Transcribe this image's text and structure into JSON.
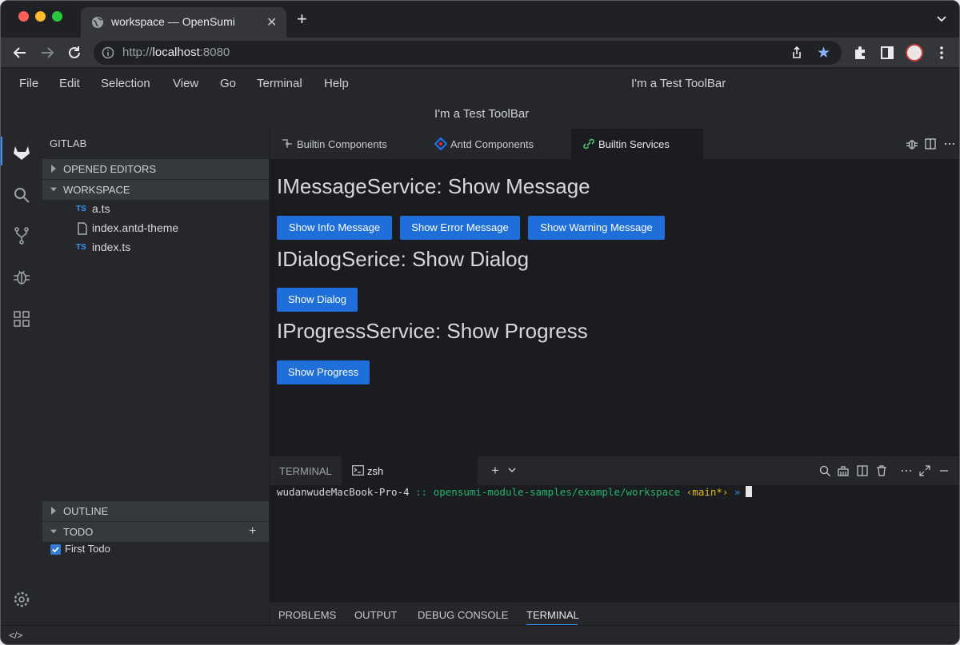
{
  "browser": {
    "traffic_lights": {
      "close": "#ff5f57",
      "minimize": "#febc2e",
      "maximize": "#28c840"
    },
    "tab": {
      "title": "workspace — OpenSumi",
      "icon": "globe-icon",
      "close_glyph": "✕"
    },
    "new_tab_glyph": "+",
    "url": {
      "scheme": "http://",
      "host": "localhost",
      "port": ":8080"
    },
    "star_glyph": "★"
  },
  "ide": {
    "menus": [
      "File",
      "Edit",
      "Selection",
      "View",
      "Go",
      "Terminal",
      "Help"
    ],
    "toolbar_text": "I'm a Test ToolBar",
    "toolbar_text_2": "I'm a Test ToolBar",
    "activity_icons": [
      "gitlab-icon",
      "search-icon",
      "source-control-icon",
      "debug-icon",
      "extensions-icon",
      "settings-icon"
    ],
    "sidebar": {
      "title": "GITLAB",
      "opened_editors": "OPENED EDITORS",
      "workspace": "WORKSPACE",
      "files": [
        {
          "icon": "TS",
          "name": "a.ts"
        },
        {
          "icon": "file-icon",
          "name": "index.antd-theme"
        },
        {
          "icon": "TS",
          "name": "index.ts"
        }
      ],
      "outline": "OUTLINE",
      "todo": "TODO",
      "todo_add": "+",
      "todo_items": [
        {
          "label": "First Todo",
          "checked": true
        }
      ]
    },
    "editor_tabs": [
      {
        "label": "Builtin Components",
        "icon": "components-icon"
      },
      {
        "label": "Antd Components",
        "icon": "antd-icon"
      },
      {
        "label": "Builtin Services",
        "icon": "link-icon",
        "active": true
      }
    ],
    "content": {
      "message_heading": "IMessageService: Show Message",
      "btn_info": "Show Info Message",
      "btn_error": "Show Error Message",
      "btn_warning": "Show Warning Message",
      "dialog_heading": "IDialogSerice: Show Dialog",
      "btn_dialog": "Show Dialog",
      "progress_heading": "IProgressService: Show Progress",
      "btn_progress": "Show Progress"
    },
    "panel": {
      "tab_terminal": "TERMINAL",
      "tab_zsh": "zsh",
      "add_glyph": "+",
      "dropdown_glyph": "⌄",
      "prompt": {
        "host": "wudanwudeMacBook-Pro-4",
        "sep": " :: ",
        "path": "opensumi-module-samples/example/workspace",
        "branch": " ‹main*› ",
        "arrow": "»"
      },
      "bottom_tabs": [
        "PROBLEMS",
        "OUTPUT",
        "DEBUG CONSOLE",
        "TERMINAL"
      ],
      "active_bottom_tab": "TERMINAL"
    },
    "status": {
      "icon": "</>"
    }
  }
}
